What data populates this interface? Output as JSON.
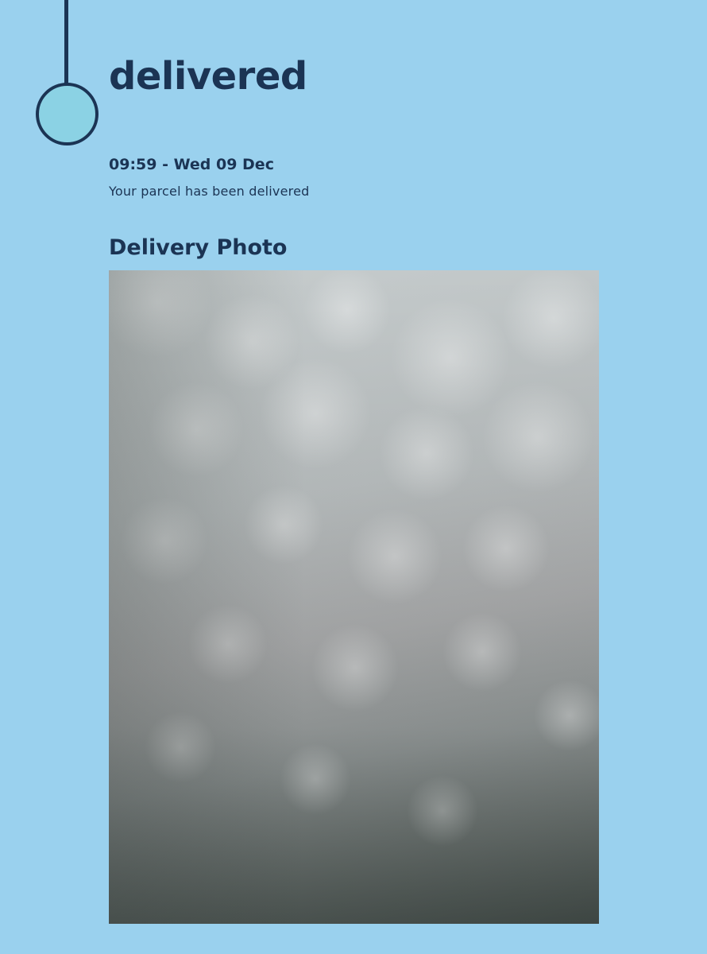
{
  "status": {
    "title": "delivered",
    "time_label": "09:59 - Wed 09 Dec",
    "description": "Your parcel has been delivered"
  },
  "delivery_photo": {
    "heading": "Delivery Photo"
  },
  "colors": {
    "background": "#9ad1ee",
    "text": "#1b3454",
    "timeline_node_fill": "#8bd2e4"
  }
}
